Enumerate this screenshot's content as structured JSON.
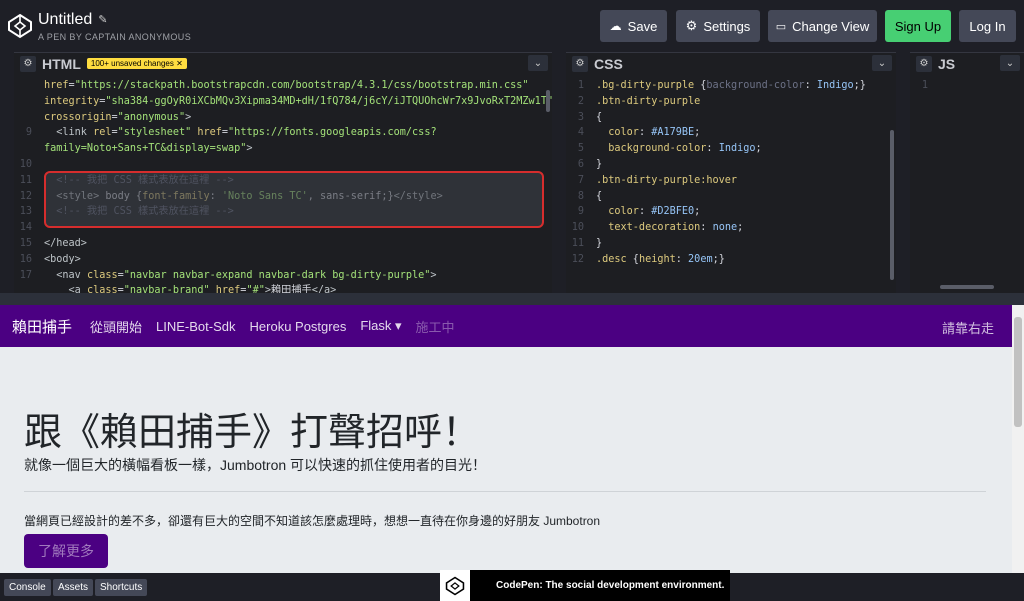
{
  "header": {
    "title": "Untitled",
    "byline": "A PEN BY CAPTAIN ANONYMOUS",
    "save": "Save",
    "settings": "Settings",
    "change_view": "Change View",
    "sign_up": "Sign Up",
    "log_in": "Log In"
  },
  "panes": {
    "html": {
      "label": "HTML",
      "badge": "100+ unsaved changes"
    },
    "css": {
      "label": "CSS"
    },
    "js": {
      "label": "JS"
    }
  },
  "html_code": [
    {
      "n": "",
      "parts": [
        [
          "t-attr",
          "href"
        ],
        [
          "",
          "="
        ],
        [
          "t-str",
          "\"https://stackpath.bootstrapcdn.com/bootstrap/4.3.1/css/bootstrap.min.css\""
        ]
      ]
    },
    {
      "n": "",
      "parts": [
        [
          "t-attr",
          "integrity"
        ],
        [
          "",
          "="
        ],
        [
          "t-str",
          "\"sha384-ggOyR0iXCbMQv3Xipma34MD+dH/1fQ784/j6cY/iJTQUOhcWr7x9JvoRxT2MZw1T\""
        ]
      ]
    },
    {
      "n": "",
      "parts": [
        [
          "t-attr",
          "crossorigin"
        ],
        [
          "",
          "="
        ],
        [
          "t-str",
          "\"anonymous\""
        ],
        [
          "t-tag",
          ">"
        ]
      ]
    },
    {
      "n": "9",
      "parts": [
        [
          "t-tag",
          "  <link "
        ],
        [
          "t-attr",
          "rel"
        ],
        [
          "",
          "="
        ],
        [
          "t-str",
          "\"stylesheet\""
        ],
        [
          "t-attr",
          " href"
        ],
        [
          "",
          "="
        ],
        [
          "t-str",
          "\"https://fonts.googleapis.com/css?"
        ]
      ]
    },
    {
      "n": "",
      "parts": [
        [
          "t-str",
          "family=Noto+Sans+TC&display=swap\""
        ],
        [
          "t-tag",
          ">"
        ]
      ]
    },
    {
      "n": "10",
      "parts": []
    },
    {
      "n": "11",
      "parts": [
        [
          "t-cmt",
          "  <!-- 我把 CSS 樣式表放在這裡 -->"
        ]
      ]
    },
    {
      "n": "12",
      "parts": [
        [
          "t-tag",
          "  <style>"
        ],
        [
          "",
          " body {"
        ],
        [
          "t-prop",
          "font-family"
        ],
        [
          "",
          ": "
        ],
        [
          "t-str",
          "'Noto Sans TC'"
        ],
        [
          "",
          ", sans-serif;}"
        ],
        [
          "t-tag",
          "</style>"
        ]
      ]
    },
    {
      "n": "13",
      "parts": [
        [
          "t-cmt",
          "  <!-- 我把 CSS 樣式表放在這裡 -->"
        ]
      ]
    },
    {
      "n": "14",
      "parts": []
    },
    {
      "n": "15",
      "parts": [
        [
          "t-tag",
          "</head>"
        ]
      ]
    },
    {
      "n": "16",
      "parts": [
        [
          "t-tag",
          "<body>"
        ]
      ]
    },
    {
      "n": "17",
      "parts": [
        [
          "t-tag",
          "  <nav "
        ],
        [
          "t-attr",
          "class"
        ],
        [
          "",
          "="
        ],
        [
          "t-str",
          "\"navbar navbar-expand navbar-dark bg-dirty-purple\""
        ],
        [
          "t-tag",
          ">"
        ]
      ]
    },
    {
      "n": "",
      "parts": [
        [
          "t-tag",
          "    <a "
        ],
        [
          "t-attr",
          "class"
        ],
        [
          "",
          "="
        ],
        [
          "t-str",
          "\"navbar-brand\""
        ],
        [
          "t-attr",
          " href"
        ],
        [
          "",
          "="
        ],
        [
          "t-str",
          "\"#\""
        ],
        [
          "t-tag",
          ">"
        ],
        [
          "",
          "賴田捕手"
        ],
        [
          "t-tag",
          "</a>"
        ]
      ]
    }
  ],
  "css_code": [
    {
      "n": "1",
      "parts": [
        [
          "t-sel",
          ".bg-dirty-purple"
        ],
        [
          "",
          " {"
        ],
        [
          "t-cmt",
          "background-color"
        ],
        [
          "",
          ": "
        ],
        [
          "t-val",
          "Indigo"
        ],
        [
          "",
          ";}"
        ]
      ]
    },
    {
      "n": "2",
      "parts": [
        [
          "t-sel",
          ".btn-dirty-purple"
        ]
      ]
    },
    {
      "n": "3",
      "parts": [
        [
          "",
          "{"
        ]
      ]
    },
    {
      "n": "4",
      "parts": [
        [
          "t-prop",
          "  color"
        ],
        [
          "",
          ": "
        ],
        [
          "t-val",
          "#A179BE"
        ],
        [
          "",
          ";"
        ]
      ]
    },
    {
      "n": "5",
      "parts": [
        [
          "t-prop",
          "  background-color"
        ],
        [
          "",
          ": "
        ],
        [
          "t-val",
          "Indigo"
        ],
        [
          "",
          ";"
        ]
      ]
    },
    {
      "n": "6",
      "parts": [
        [
          "",
          "}"
        ]
      ]
    },
    {
      "n": "7",
      "parts": [
        [
          "t-sel",
          ".btn-dirty-purple:hover"
        ]
      ]
    },
    {
      "n": "8",
      "parts": [
        [
          "",
          "{"
        ]
      ]
    },
    {
      "n": "9",
      "parts": [
        [
          "t-prop",
          "  color"
        ],
        [
          "",
          ": "
        ],
        [
          "t-val",
          "#D2BFE0"
        ],
        [
          "",
          ";"
        ]
      ]
    },
    {
      "n": "10",
      "parts": [
        [
          "t-prop",
          "  text-decoration"
        ],
        [
          "",
          ": "
        ],
        [
          "t-val",
          "none"
        ],
        [
          "",
          ";"
        ]
      ]
    },
    {
      "n": "11",
      "parts": [
        [
          "",
          "}"
        ]
      ]
    },
    {
      "n": "12",
      "parts": [
        [
          "t-sel",
          ".desc"
        ],
        [
          "",
          " {"
        ],
        [
          "t-prop",
          "height"
        ],
        [
          "",
          ": "
        ],
        [
          "t-val",
          "20em"
        ],
        [
          "",
          ";}"
        ]
      ]
    }
  ],
  "js_code": [
    {
      "n": "1",
      "parts": []
    }
  ],
  "preview": {
    "brand": "賴田捕手",
    "nav": [
      "從頭開始",
      "LINE-Bot-Sdk",
      "Heroku Postgres",
      "Flask ▾",
      "施工中"
    ],
    "nav_right": "請靠右走",
    "heading": "跟《賴田捕手》打聲招呼！",
    "lead": "就像一個巨大的橫幅看板一樣，Jumbotron 可以快速的抓住使用者的目光！",
    "paragraph": "當網頁已經設計的差不多，卻還有巨大的空間不知道該怎麼處理時，想想一直待在你身邊的好朋友 Jumbotron",
    "button": "了解更多"
  },
  "footer": {
    "console": "Console",
    "assets": "Assets",
    "shortcuts": "Shortcuts",
    "toast": "CodePen: The social development environment."
  },
  "colors": {
    "navbar": "#4b0082",
    "button_text": "#A179BE",
    "green": "#47cf73",
    "highlight": "#d62d2d"
  }
}
